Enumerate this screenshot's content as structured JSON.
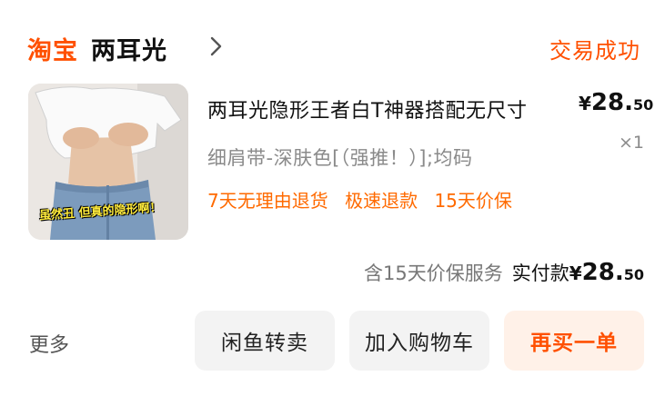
{
  "header": {
    "brand": "淘宝",
    "shop_name": "两耳光",
    "chevron_icon": "chevron-right-icon",
    "status": "交易成功"
  },
  "item": {
    "title": "两耳光隐形王者白T神器搭配无尺寸",
    "price": {
      "currency": "¥",
      "integer": "28.",
      "decimal": "50"
    },
    "sku": "细肩带-深肤色[（强推！）];均码",
    "quantity": "×1",
    "thumbnail_caption": "虽然丑 但真的隐形啊！",
    "services": [
      "7天无理由退货",
      "极速退款",
      "15天价保"
    ]
  },
  "summary": {
    "note": "含15天价保服务",
    "paid_label": "实付款",
    "currency": "¥",
    "integer": "28.",
    "decimal": "50"
  },
  "actions": {
    "more": "更多",
    "idle_fish": "闲鱼转卖",
    "add_to_cart": "加入购物车",
    "buy_again": "再买一单"
  },
  "colors": {
    "accent": "#ff5000",
    "service_text": "#ff6a00",
    "button_bg": "#f3f3f3",
    "buy_again_bg": "#fff1e8"
  }
}
